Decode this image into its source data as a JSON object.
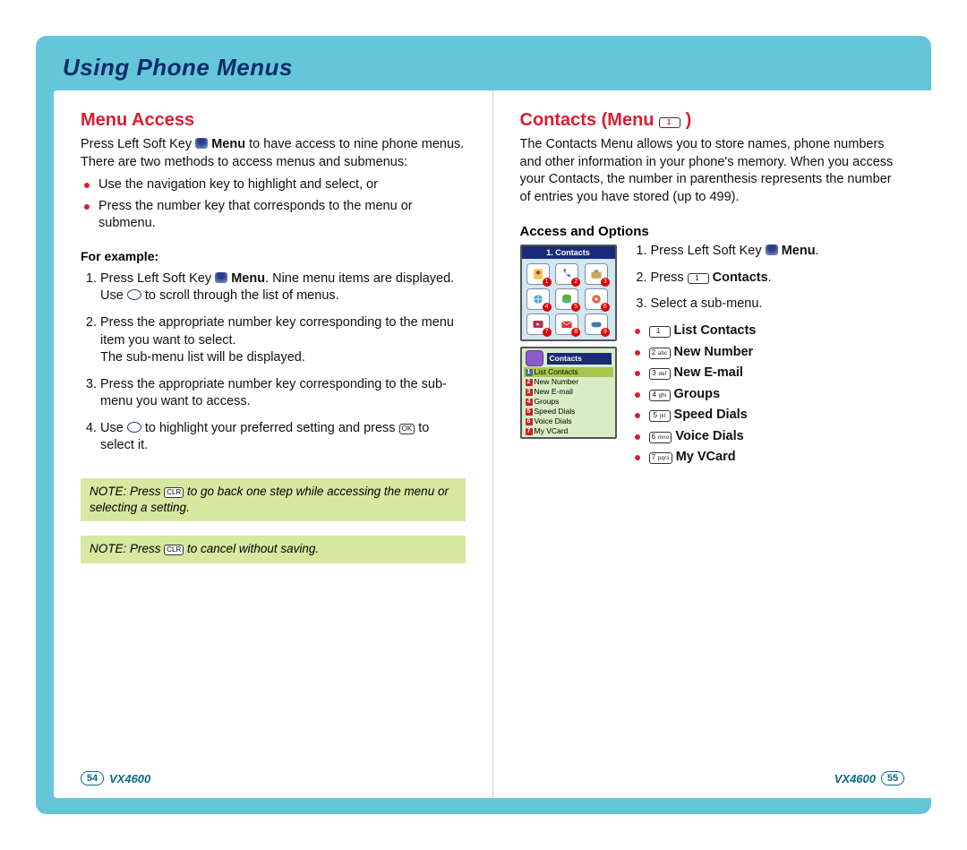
{
  "doc_title": "Using Phone Menus",
  "left": {
    "heading": "Menu Access",
    "intro_pre": "Press Left Soft Key ",
    "intro_mid_bold": "Menu",
    "intro_post": " to have access to nine phone menus. There are two methods to access menus and submenus:",
    "bullets": [
      "Use the navigation key to highlight and select, or",
      "Press the number key that corresponds to the menu or submenu."
    ],
    "example_label": "For example:",
    "steps": {
      "s1_pre": "Press Left Soft Key ",
      "s1_mid_bold": "Menu",
      "s1_post_line2": ". Nine menu items are displayed.",
      "s1_line3_pre": "Use ",
      "s1_line3_post": " to scroll through the list of menus.",
      "s2": "Press the appropriate number key corresponding to the menu item you want to select.",
      "s2_line2": "The sub-menu list will be displayed.",
      "s3": "Press the appropriate number key corresponding to the sub-menu you want to access.",
      "s4_pre": "Use ",
      "s4_mid": " to highlight your preferred setting and press ",
      "s4_ok": "OK",
      "s4_post": " to select it."
    },
    "note1_pre": "NOTE: Press ",
    "note1_clr": "CLR",
    "note1_post": " to go back one step while accessing the menu or selecting a setting.",
    "note2_pre": "NOTE: Press ",
    "note2_clr": "CLR",
    "note2_post": " to cancel without saving.",
    "page_num": "54",
    "model": "VX4600"
  },
  "right": {
    "heading_pre": "Contacts (Menu ",
    "heading_key": "1",
    "heading_post": " )",
    "intro": "The Contacts Menu allows you to store names, phone numbers and other information in your phone's memory. When you access your Contacts, the number in parenthesis represents the number of entries you have stored (up to 499).",
    "sub_heading": "Access and Options",
    "screen_main_title": "1. Contacts",
    "screen_sub_title": "Contacts",
    "screen_list": [
      "List Contacts",
      "New Number",
      "New E-mail",
      "Groups",
      "Speed Dials",
      "Voice Dials",
      "My VCard"
    ],
    "steps": {
      "s1_pre": "Press Left Soft Key ",
      "s1_bold": "Menu",
      "s1_post": ".",
      "s2_pre": "Press ",
      "s2_key": "1",
      "s2_bold": "Contacts",
      "s2_post": ".",
      "s3": "Select a sub-menu."
    },
    "submenu": [
      {
        "key": "1",
        "letters": "",
        "label": "List Contacts"
      },
      {
        "key": "2",
        "letters": "abc",
        "label": "New Number"
      },
      {
        "key": "3",
        "letters": "def",
        "label": "New E-mail"
      },
      {
        "key": "4",
        "letters": "ghi",
        "label": "Groups"
      },
      {
        "key": "5",
        "letters": "jkl",
        "label": "Speed Dials"
      },
      {
        "key": "6",
        "letters": "mno",
        "label": "Voice Dials"
      },
      {
        "key": "7",
        "letters": "pqrs",
        "label": "My VCard"
      }
    ],
    "page_num": "55",
    "model": "VX4600"
  }
}
